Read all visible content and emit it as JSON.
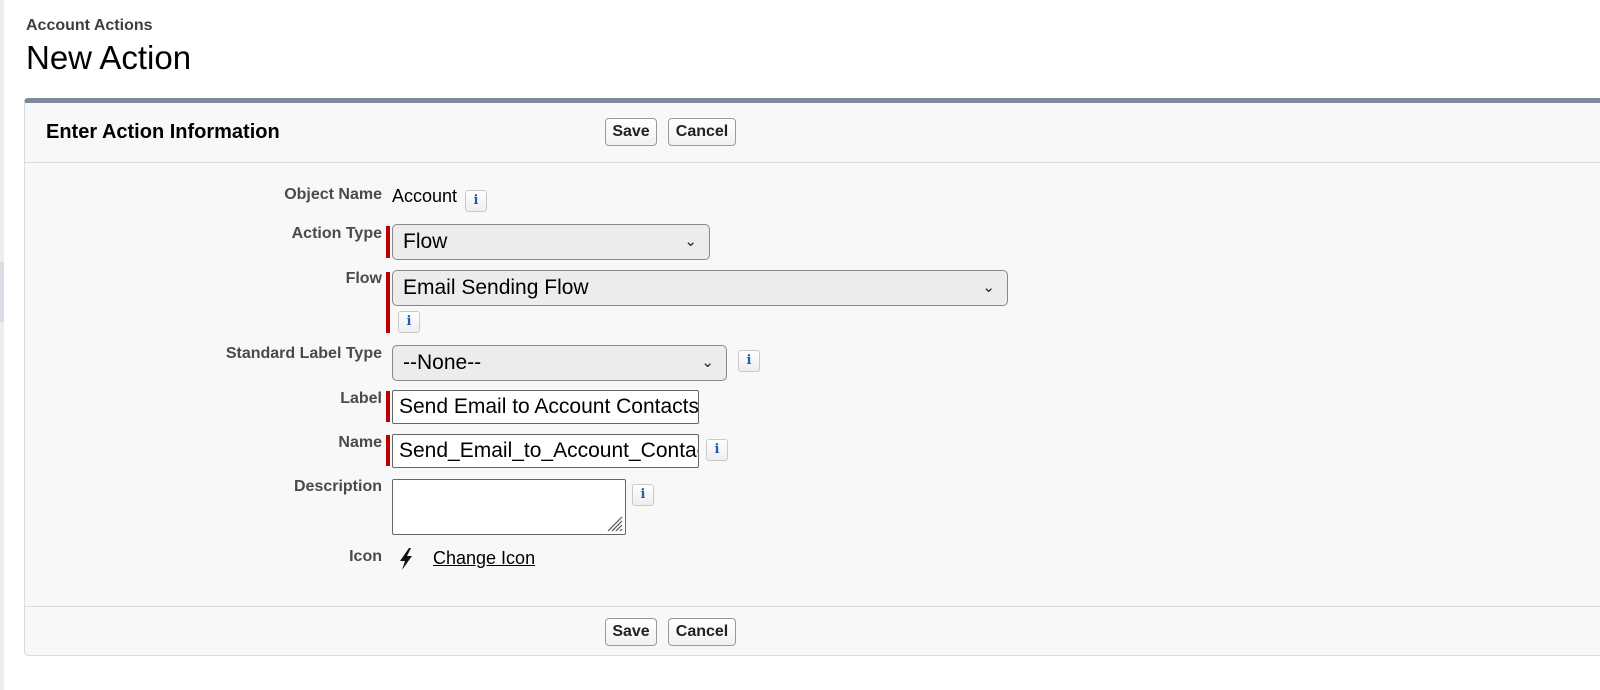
{
  "header": {
    "object_type": "Account Actions",
    "title": "New Action"
  },
  "panel": {
    "title": "Enter Action Information",
    "save_label": "Save",
    "cancel_label": "Cancel"
  },
  "form": {
    "object_name": {
      "label": "Object Name",
      "value": "Account"
    },
    "action_type": {
      "label": "Action Type",
      "value": "Flow",
      "required": true
    },
    "flow": {
      "label": "Flow",
      "value": "Email Sending Flow",
      "required": true
    },
    "standard_label_type": {
      "label": "Standard Label Type",
      "value": "--None--"
    },
    "label_field": {
      "label": "Label",
      "value": "Send Email to Account Contacts",
      "required": true
    },
    "name_field": {
      "label": "Name",
      "value": "Send_Email_to_Account_Contacts",
      "required": true
    },
    "description": {
      "label": "Description",
      "value": ""
    },
    "icon": {
      "label": "Icon",
      "link_text": "Change Icon",
      "icon_name": "lightning-bolt-icon"
    }
  },
  "icons": {
    "info": "i",
    "info_icon_name": "info-icon",
    "dropdown_icon_name": "chevron-down-icon"
  },
  "colors": {
    "required_bar": "#c00000",
    "panel_top_border": "#7c8a9a",
    "info_glyph": "#1b5fb0"
  }
}
